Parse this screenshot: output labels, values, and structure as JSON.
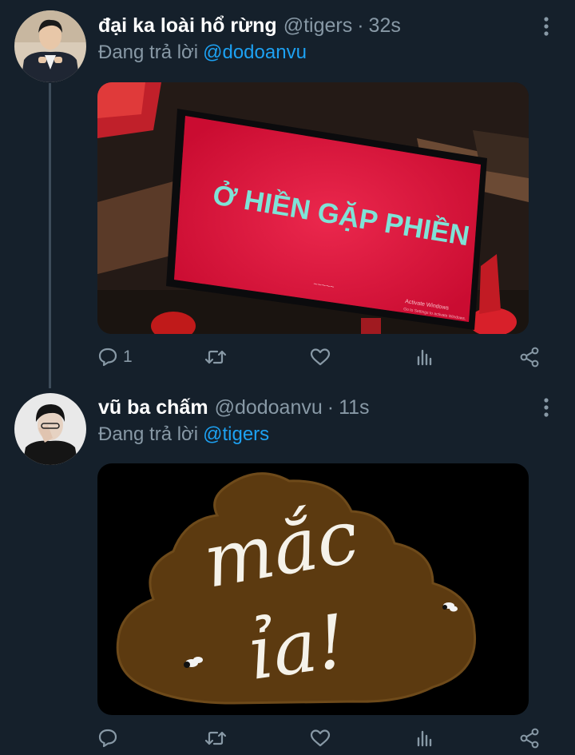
{
  "tweets": [
    {
      "display_name": "đại ka loài hổ rừng",
      "handle": "@tigers",
      "separator": "·",
      "time": "32s",
      "reply_prefix": "Đang trả lời",
      "reply_to": "@dodoanvu",
      "media": {
        "screen_text": "Ở HIỀN GẶP PHIỀN",
        "watermark_line1": "Activate Windows",
        "watermark_line2": "Go to Settings to activate Windows.",
        "screen_color": "#e0123a"
      },
      "actions": {
        "reply_count": "1",
        "retweet_count": "",
        "like_count": ""
      }
    },
    {
      "display_name": "vũ ba chấm",
      "handle": "@dodoanvu",
      "separator": "·",
      "time": "11s",
      "reply_prefix": "Đang trả lời",
      "reply_to": "@tigers",
      "media": {
        "sticker_line1": "mắc",
        "sticker_line2": "ỉa!",
        "sticker_color": "#5c3a10"
      },
      "actions": {
        "reply_count": "",
        "retweet_count": "",
        "like_count": ""
      }
    }
  ],
  "colors": {
    "background": "#15202b",
    "muted_text": "#8899a6",
    "accent": "#1da1f2",
    "thread_line": "#3d4c5a"
  },
  "icons": [
    "more-vertical-icon",
    "reply-icon",
    "retweet-icon",
    "like-icon",
    "stats-icon",
    "share-icon"
  ]
}
